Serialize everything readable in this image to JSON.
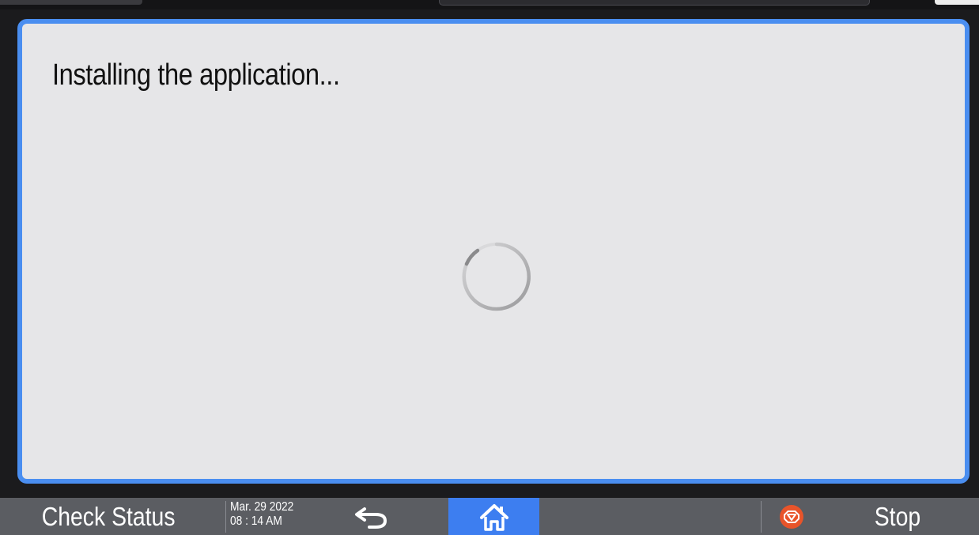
{
  "dialog": {
    "message": "Installing the application..."
  },
  "bottom_bar": {
    "check_status_label": "Check Status",
    "date": "Mar. 29 2022",
    "time": "08 : 14 AM",
    "stop_label": "Stop"
  },
  "colors": {
    "accent": "#4a8ef0",
    "home_button": "#3d7ef0",
    "stop_icon": "#e8542a",
    "bar": "#5b5d62",
    "dialog_bg": "#e6e6e8"
  },
  "icons": {
    "back": "back-arrow-icon",
    "home": "home-icon",
    "stop": "stop-icon",
    "loading": "loading-spinner-icon"
  }
}
